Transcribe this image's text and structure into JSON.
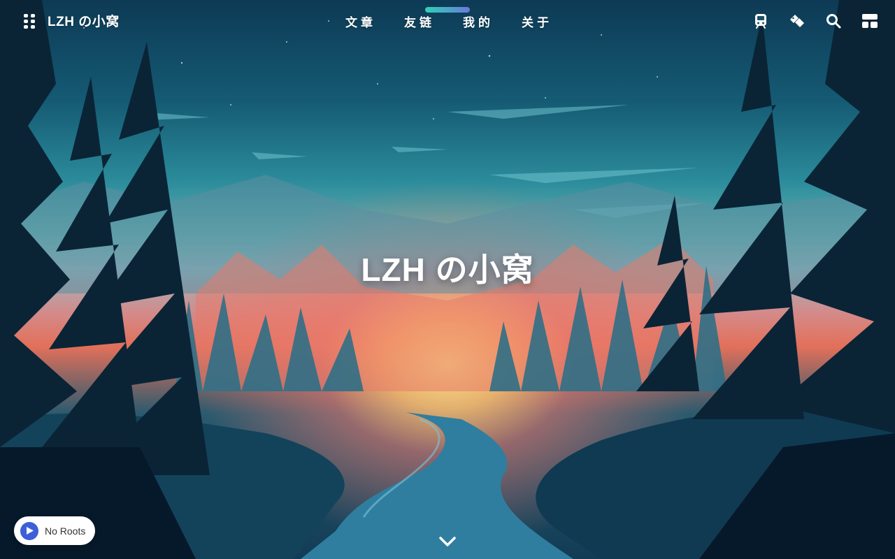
{
  "site": {
    "title": "LZH の小窝",
    "hero_title": "LZH の小窝"
  },
  "nav": {
    "items": [
      {
        "label": "文章"
      },
      {
        "label": "友链"
      },
      {
        "label": "我的"
      },
      {
        "label": "关于"
      }
    ],
    "icons": [
      "subway-icon",
      "tags-icon",
      "search-icon",
      "layout-icon"
    ]
  },
  "player": {
    "label": "No Roots",
    "state_icon": "play-icon"
  },
  "colors": {
    "accent": "#3d5fd8",
    "indicator_start": "#2fd0b8",
    "indicator_end": "#6a7ad8"
  }
}
